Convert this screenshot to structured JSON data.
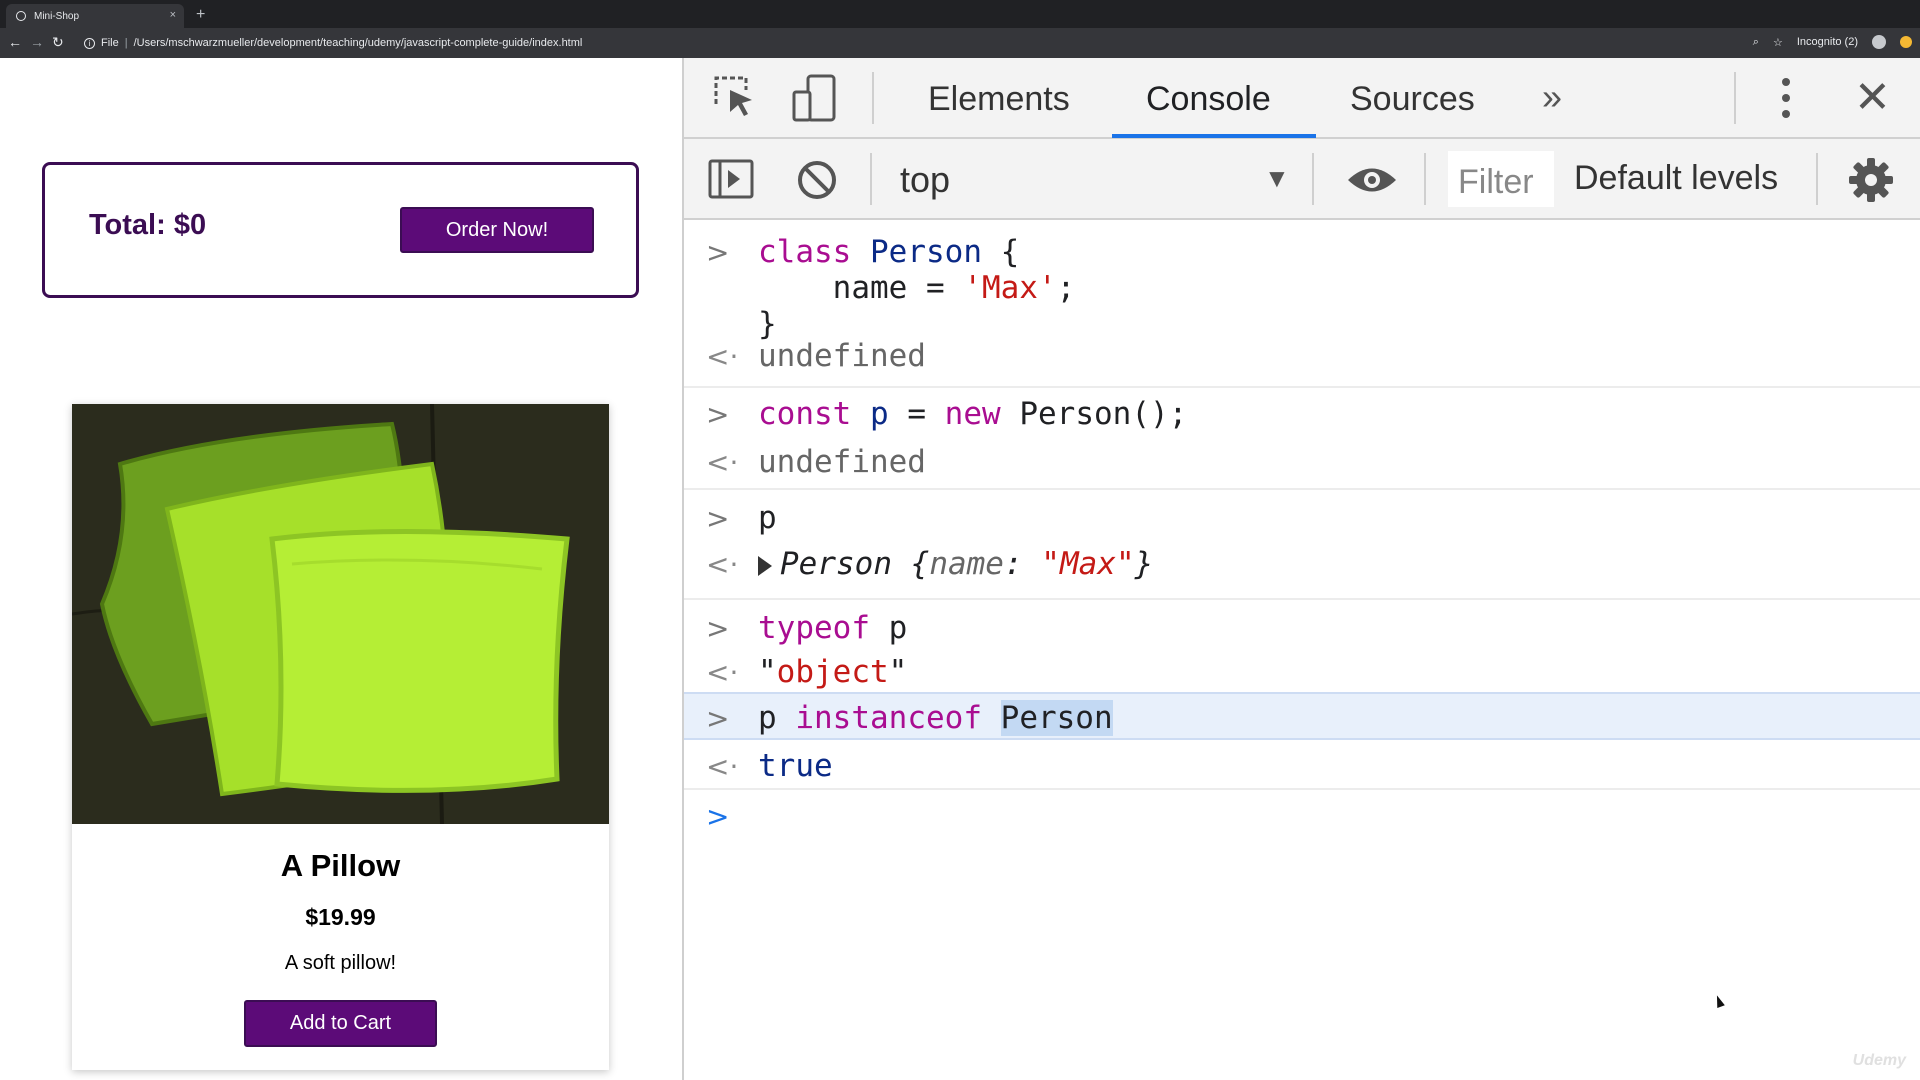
{
  "browser": {
    "tab_title": "Mini-Shop",
    "tab_close": "×",
    "new_tab": "+",
    "back": "←",
    "forward": "→",
    "reload": "↻",
    "address_scheme": "File",
    "address_url": "/Users/mschwarzmueller/development/teaching/udemy/javascript-complete-guide/index.html",
    "incognito_label": "Incognito (2)"
  },
  "shop": {
    "total_label": "Total: $0",
    "order_button": "Order Now!",
    "product": {
      "name": "A Pillow",
      "price": "$19.99",
      "description": "A soft pillow!",
      "add_button": "Add to Cart"
    }
  },
  "devtools": {
    "tabs": [
      "Elements",
      "Console",
      "Sources"
    ],
    "active_tab": "Console",
    "more_tabs": "»",
    "close": "✕",
    "context": "top",
    "filter_placeholder": "Filter",
    "levels": "Default levels"
  },
  "console": {
    "input1_line1_kw": "class",
    "input1_line1_name": "Person",
    "input1_line1_brace": " {",
    "input1_line2_name": "name",
    "input1_line2_eq": " = ",
    "input1_line2_str": "'Max'",
    "input1_line2_end": ";",
    "input1_line3": "}",
    "output1": "undefined",
    "input2_kw1": "const",
    "input2_var": "p",
    "input2_eq": " = ",
    "input2_kw2": "new",
    "input2_rest": " Person();",
    "output2": "undefined",
    "input3": "p",
    "output3_class": "Person",
    "output3_open": " {",
    "output3_key": "name",
    "output3_colon": ": ",
    "output3_val": "\"Max\"",
    "output3_close": "}",
    "input4_kw": "typeof",
    "input4_rest": " p",
    "output4_q1": "\"",
    "output4_val": "object",
    "output4_q2": "\"",
    "input5_var": "p",
    "input5_kw": "instanceof",
    "input5_sel": "Person",
    "output5": "true"
  },
  "watermark": "Udemy",
  "colors": {
    "accent_purple": "#5c0b78",
    "border_purple": "#3b0d53",
    "devtools_blue": "#1a73e8"
  }
}
